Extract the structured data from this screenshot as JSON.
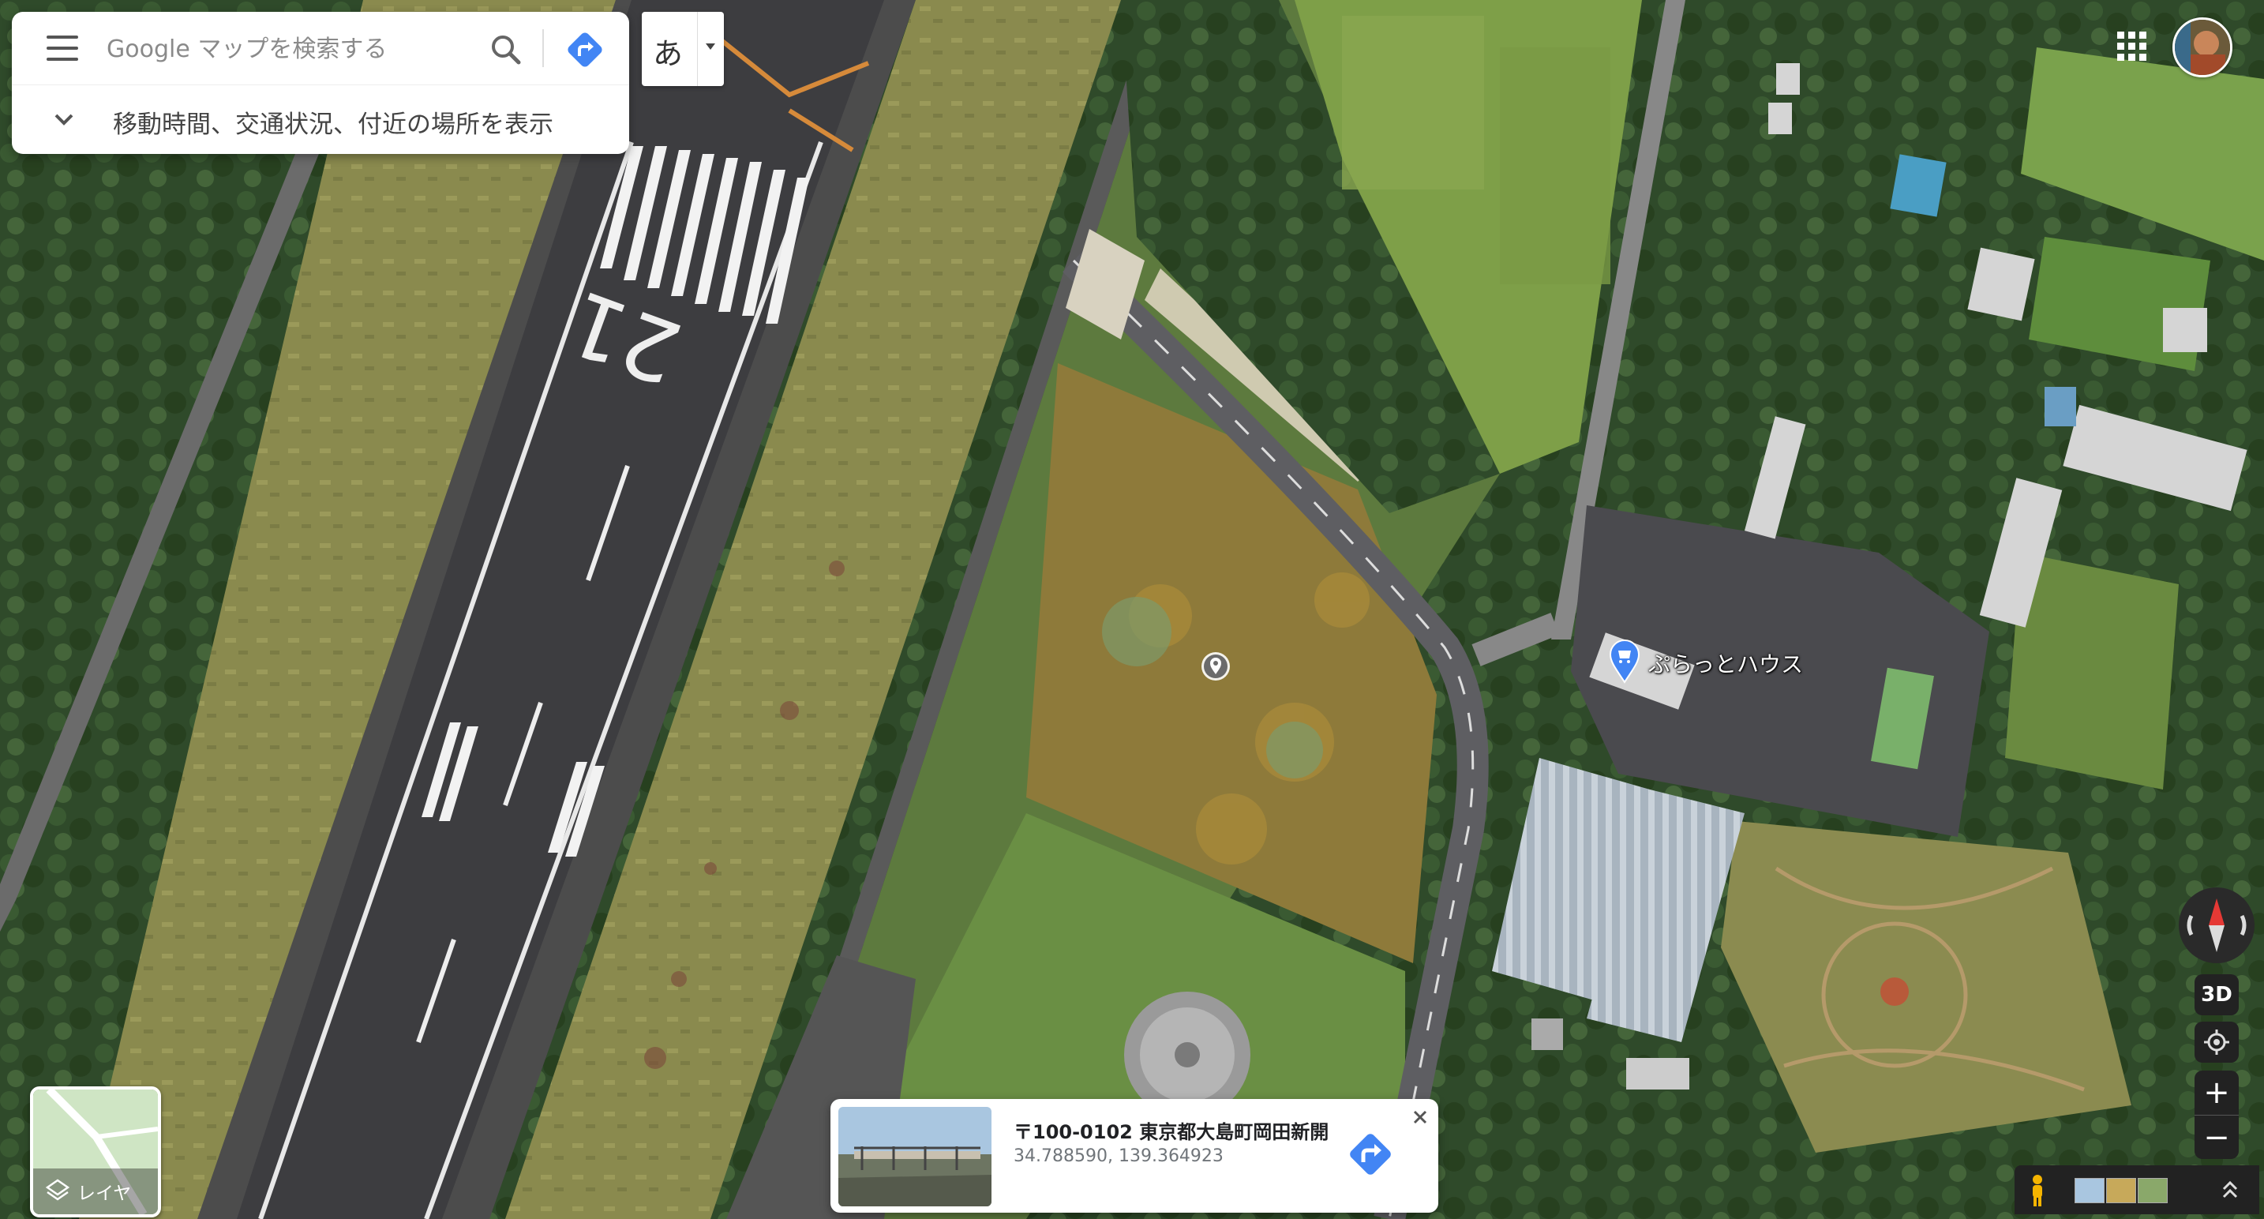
{
  "search": {
    "placeholder": "Google マップを検索する",
    "info_text": "移動時間、交通状況、付近の場所を表示"
  },
  "ime": {
    "label": "あ"
  },
  "layers": {
    "label": "レイヤ"
  },
  "map": {
    "poi_label": "ぷらっとハウス"
  },
  "place_card": {
    "title": "〒100-0102 東京都大島町岡田新開",
    "coords": "34.788590, 139.364923"
  },
  "controls": {
    "three_d_label": "3D",
    "zoom_in": "+",
    "zoom_out": "−"
  },
  "colors": {
    "accent_blue": "#4285f4",
    "panel_bg": "#ffffff",
    "control_bg": "#222222"
  }
}
